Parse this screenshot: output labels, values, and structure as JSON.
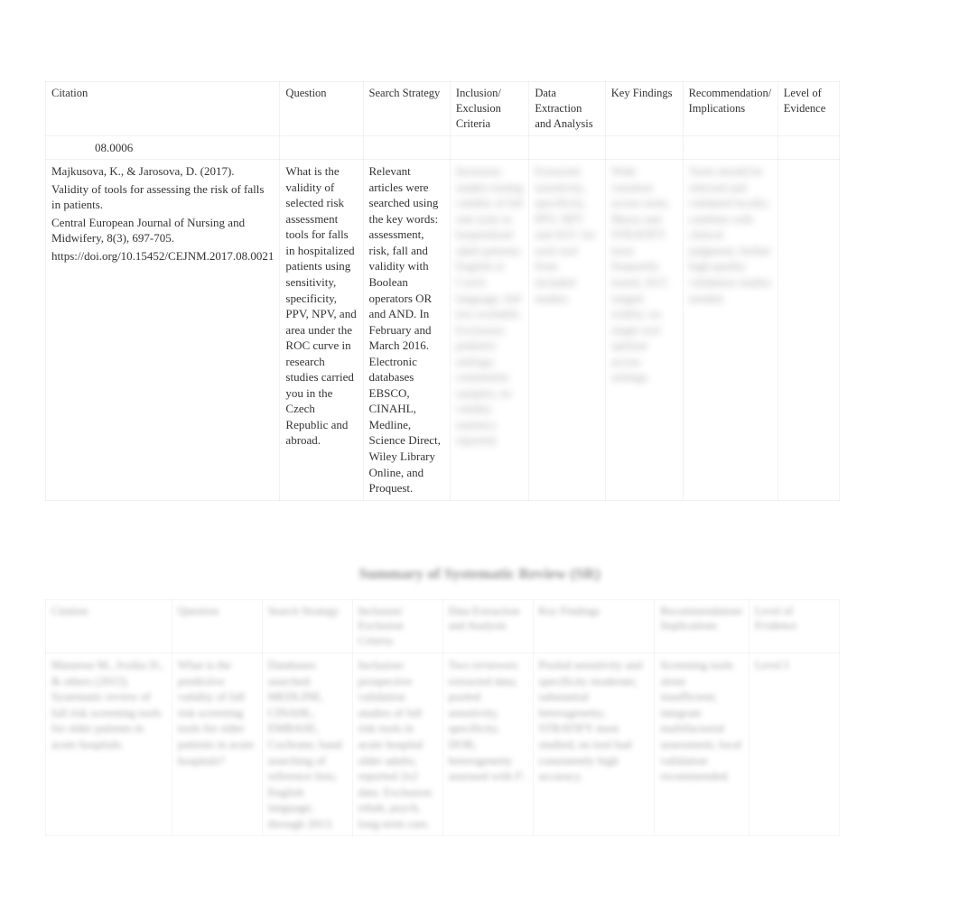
{
  "table1": {
    "headers": {
      "citation": "Citation",
      "question": "Question",
      "search": "Search Strategy",
      "inclusion": "Inclusion/ Exclusion Criteria",
      "data": "Data Extraction and Analysis",
      "findings": "Key Findings",
      "rec": "Recommendation/ Implications",
      "level": "Level of Evidence"
    },
    "row_partial": {
      "citation": "08.0006"
    },
    "row_main": {
      "citation_author": "Majkusova, K., & Jarosova, D. (2017).",
      "citation_title": "Validity of tools for assessing the risk of falls in patients.",
      "citation_journal": "Central European Journal of Nursing and Midwifery, 8(3), 697-705.",
      "citation_doi": "https://doi.org/10.15452/CEJNM.2017.08.0021",
      "question": "What is the validity of selected risk assessment tools for falls in hospitalized patients using sensitivity, specificity, PPV, NPV, and area under the ROC curve in research studies carried you in the Czech Republic and abroad.",
      "search": "Relevant articles were searched using the key words: assessment, risk, fall and validity with Boolean operators OR and AND. In February and March 2016. Electronic databases EBSCO, CINAHL, Medline, Science Direct, Wiley Library Online, and Proquest.",
      "inclusion_blur": "Inclusion: studies testing validity of fall risk tools in hospitalized adult patients; English or Czech language; full text available. Exclusion: pediatric settings; community samples; no validity statistics reported.",
      "data_blur": "Extracted sensitivity, specificity, PPV, NPV and AUC for each tool from included studies.",
      "findings_blur": "Wide variation across tools; Morse and STRATIFY most frequently tested; AUC ranged widely; no single tool optimal across settings.",
      "rec_blur": "Tools should be selected and validated locally; combine with clinical judgment; further high-quality validation studies needed.",
      "level_blur": ""
    }
  },
  "section2_title": "Summary of Systematic Review (SR)",
  "table2": {
    "headers": {
      "a": "Citation",
      "b": "Question",
      "c": "Search Strategy",
      "d": "Inclusion/ Exclusion Criteria",
      "e": "Data Extraction and Analysis",
      "f": "Key Findings",
      "g": "Recommendation/ Implications",
      "h": "Level of Evidence"
    },
    "row": {
      "a": "Matarese M., Ivziku D., & others (2015). Systematic review of fall risk screening tools for older patients in acute hospitals.",
      "b": "What is the predictive validity of fall risk screening tools for older patients in acute hospitals?",
      "c": "Databases searched: MEDLINE, CINAHL, EMBASE, Cochrane; hand searching of reference lists; English language; through 2013.",
      "d": "Inclusion: prospective validation studies of fall risk tools in acute hospital older adults; reported 2x2 data. Exclusion: rehab, psych, long-term care.",
      "e": "Two reviewers extracted data; pooled sensitivity, specificity, DOR; heterogeneity assessed with I².",
      "f": "Pooled sensitivity and specificity moderate; substantial heterogeneity; STRATIFY most studied; no tool had consistently high accuracy.",
      "g": "Screening tools alone insufficient; integrate multifactorial assessment; local validation recommended.",
      "h": "Level I"
    }
  }
}
